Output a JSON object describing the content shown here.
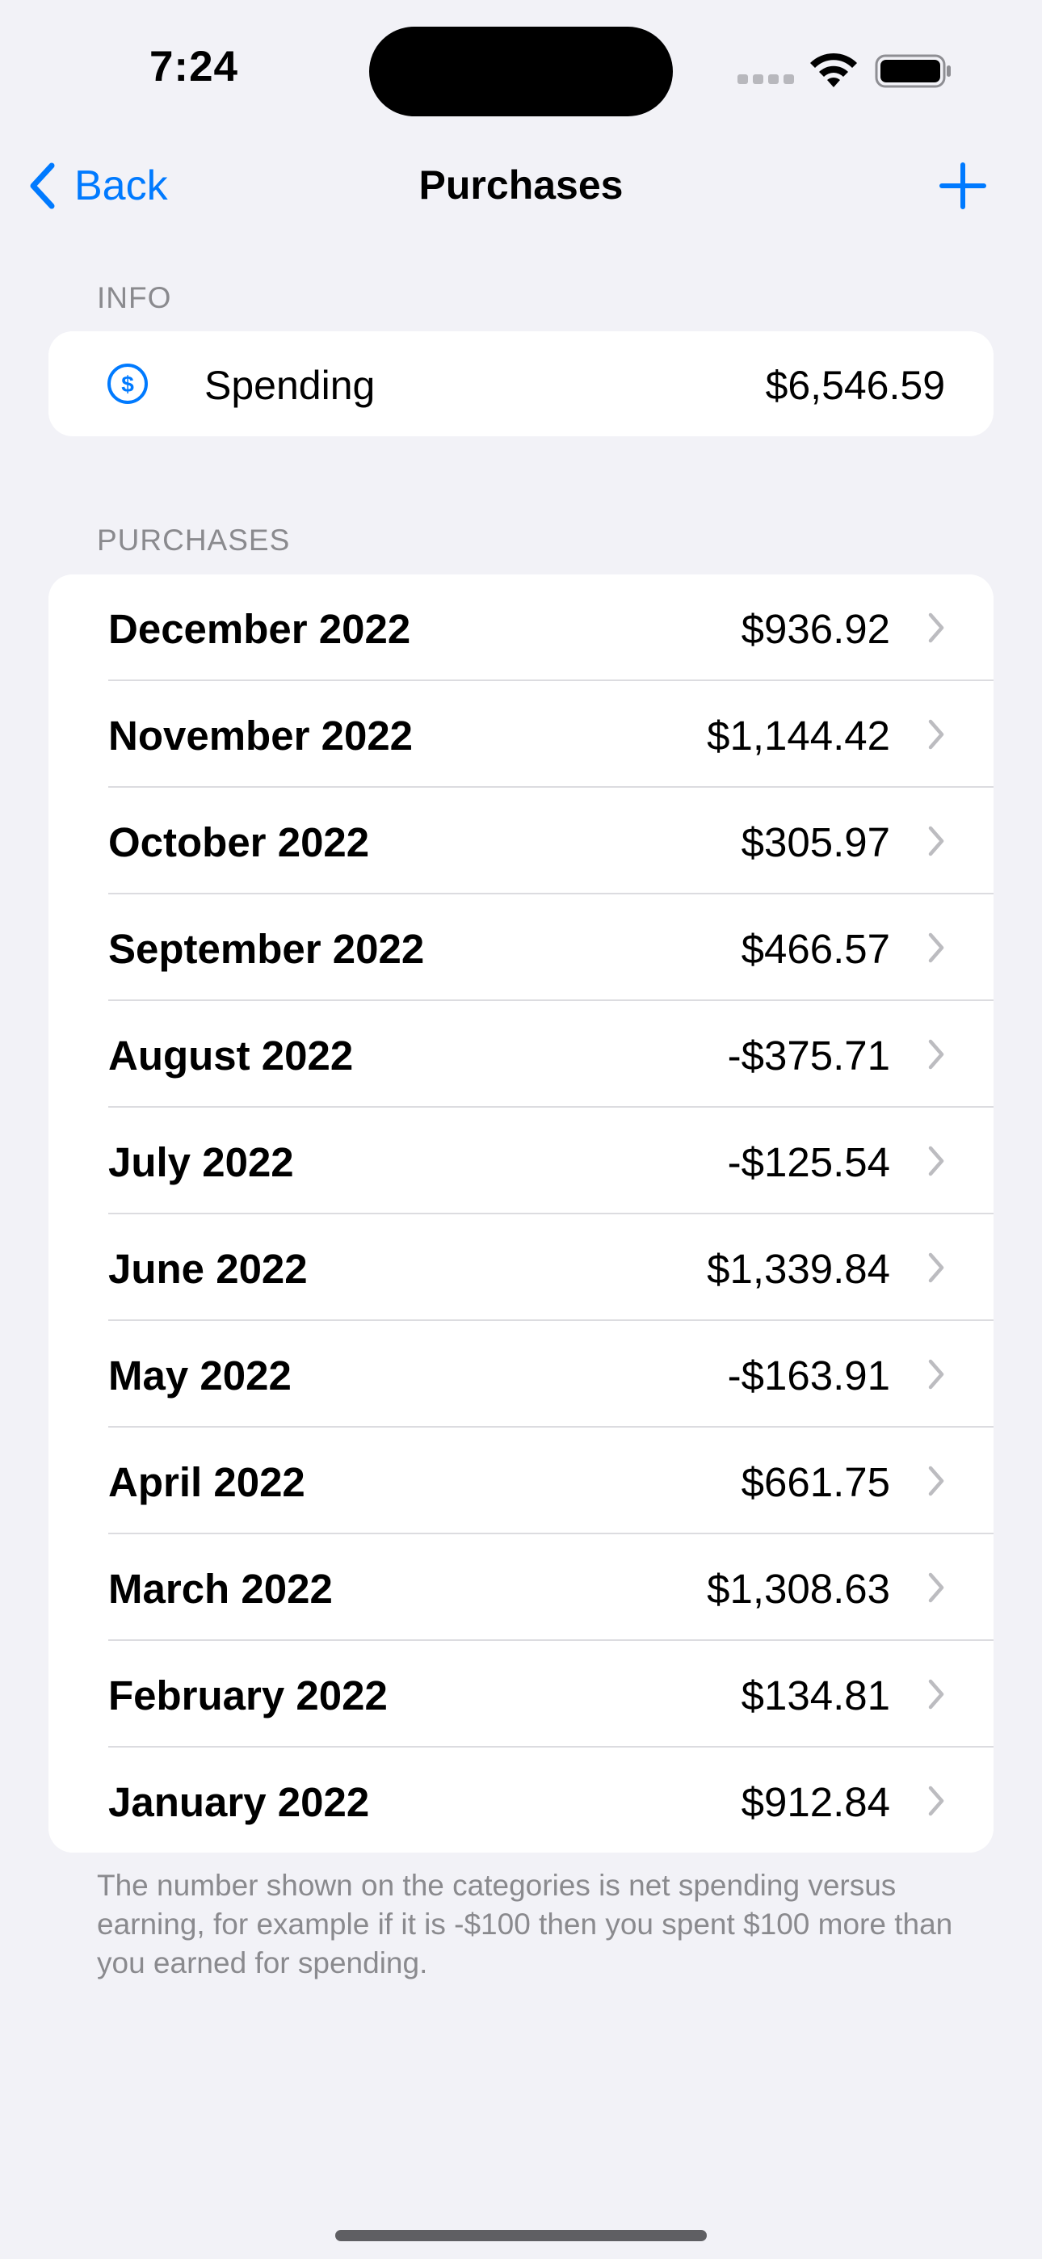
{
  "status_bar": {
    "time": "7:24"
  },
  "nav": {
    "back_label": "Back",
    "title": "Purchases"
  },
  "info": {
    "header": "INFO",
    "spending_label": "Spending",
    "spending_value": "$6,546.59"
  },
  "purchases": {
    "header": "PURCHASES",
    "rows": [
      {
        "month": "December 2022",
        "amount": "$936.92"
      },
      {
        "month": "November 2022",
        "amount": "$1,144.42"
      },
      {
        "month": "October 2022",
        "amount": "$305.97"
      },
      {
        "month": "September 2022",
        "amount": "$466.57"
      },
      {
        "month": "August 2022",
        "amount": "-$375.71"
      },
      {
        "month": "July 2022",
        "amount": "-$125.54"
      },
      {
        "month": "June 2022",
        "amount": "$1,339.84"
      },
      {
        "month": "May 2022",
        "amount": "-$163.91"
      },
      {
        "month": "April 2022",
        "amount": "$661.75"
      },
      {
        "month": "March 2022",
        "amount": "$1,308.63"
      },
      {
        "month": "February 2022",
        "amount": "$134.81"
      },
      {
        "month": "January 2022",
        "amount": "$912.84"
      }
    ],
    "footer": "The number shown on the categories is net spending versus earning, for example if it is -$100 then you spent $100 more than you earned for spending."
  },
  "colors": {
    "accent": "#007aff",
    "background": "#f2f2f7",
    "card": "#ffffff",
    "secondary_text": "#8a8a8e"
  }
}
